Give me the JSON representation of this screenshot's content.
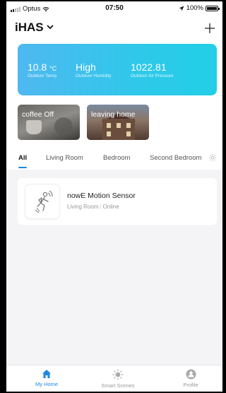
{
  "status_bar": {
    "carrier": "Optus",
    "time": "07:50",
    "battery_percent": "100%"
  },
  "header": {
    "home_name": "iHAS",
    "chevron_icon": "chevron-down-icon",
    "add_icon": "plus-icon"
  },
  "weather": {
    "temp_value": "10.8",
    "temp_unit": "°C",
    "temp_label": "Outdoor Temp",
    "humidity_value": "High",
    "humidity_label": "Outdoor Humidity",
    "pressure_value": "1022.81",
    "pressure_label": "Outdoor Air Pressure",
    "gradient_start": "#4fb8f0",
    "gradient_end": "#22cfe6"
  },
  "scenes": [
    {
      "label": "coffee Off"
    },
    {
      "label": "leaving home"
    }
  ],
  "tabs": [
    {
      "label": "All",
      "active": true
    },
    {
      "label": "Living Room",
      "active": false
    },
    {
      "label": "Bedroom",
      "active": false
    },
    {
      "label": "Second Bedroom",
      "active": false
    }
  ],
  "device": {
    "name": "nowE Motion Sensor",
    "room": "Living Room",
    "status": "Online",
    "separator": "|",
    "icon": "motion-sensor-icon"
  },
  "bottom_nav": {
    "items": [
      {
        "label": "My Home",
        "icon": "home-icon",
        "active": true
      },
      {
        "label": "Smart Scenes",
        "icon": "sun-icon",
        "active": false
      },
      {
        "label": "Profile",
        "icon": "profile-icon",
        "active": false
      }
    ],
    "accent": "#1e88e5"
  }
}
